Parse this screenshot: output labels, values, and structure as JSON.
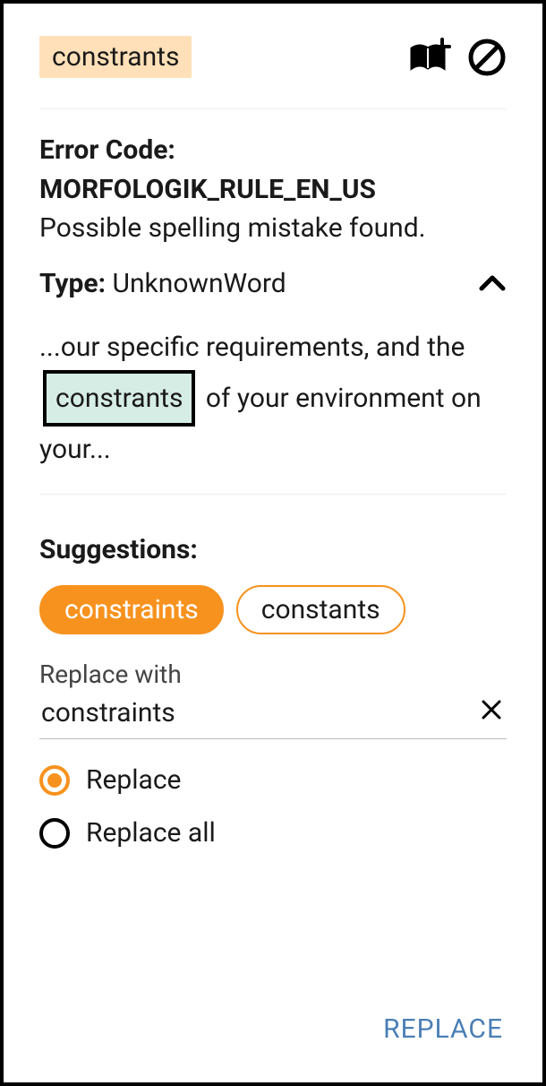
{
  "header": {
    "word": "constrants"
  },
  "error": {
    "code_label": "Error Code:",
    "code_value": "MORFOLOGIK_RULE_EN_US",
    "description": "Possible spelling mistake found.",
    "type_label": "Type:",
    "type_value": "UnknownWord"
  },
  "context": {
    "before": "...our specific requirements, and the",
    "word": "constrants",
    "after": "of your environment on your..."
  },
  "suggestions": {
    "title": "Suggestions:",
    "items": [
      "constraints",
      "constants"
    ],
    "selected_index": 0
  },
  "replace": {
    "label": "Replace with",
    "value": "constraints"
  },
  "options": {
    "replace": "Replace",
    "replace_all": "Replace all",
    "selected": "replace"
  },
  "action": {
    "button": "REPLACE"
  }
}
